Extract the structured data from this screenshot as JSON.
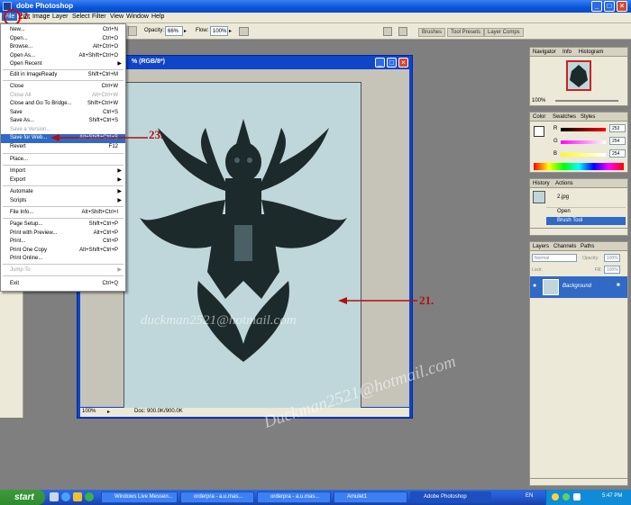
{
  "app": {
    "title": "Adobe Photoshop",
    "title_visible": "dobe Photoshop"
  },
  "menubar": [
    "File",
    "Edit",
    "Image",
    "Layer",
    "Select",
    "Filter",
    "View",
    "Window",
    "Help"
  ],
  "options_bar": {
    "opacity_label": "Opacity:",
    "opacity_value": "66%",
    "flow_label": "Flow:",
    "flow_value": "100%",
    "palette_tabs": [
      "Brushes",
      "Tool Presets",
      "Layer Comps"
    ]
  },
  "file_menu": {
    "items": [
      {
        "label": "New...",
        "shortcut": "Ctrl+N"
      },
      {
        "label": "Open...",
        "shortcut": "Ctrl+O"
      },
      {
        "label": "Browse...",
        "shortcut": "Alt+Ctrl+O"
      },
      {
        "label": "Open As...",
        "shortcut": "Alt+Shift+Ctrl+O"
      },
      {
        "label": "Open Recent",
        "submenu": true
      },
      {
        "label": "Edit in ImageReady",
        "shortcut": "Shift+Ctrl+M"
      },
      {
        "label": "Close",
        "shortcut": "Ctrl+W"
      },
      {
        "label": "Close All",
        "shortcut": "Alt+Ctrl+W",
        "disabled": true
      },
      {
        "label": "Close and Go To Bridge...",
        "shortcut": "Shift+Ctrl+W"
      },
      {
        "label": "Save",
        "shortcut": "Ctrl+S"
      },
      {
        "label": "Save As...",
        "shortcut": "Shift+Ctrl+S"
      },
      {
        "label": "Save a Version...",
        "disabled": true
      },
      {
        "label": "Save for Web...",
        "shortcut": "Alt+Shift+Ctrl+S",
        "highlighted": true
      },
      {
        "label": "Revert",
        "shortcut": "F12"
      },
      {
        "label": "Place..."
      },
      {
        "label": "Import",
        "submenu": true
      },
      {
        "label": "Export",
        "submenu": true
      },
      {
        "label": "Automate",
        "submenu": true
      },
      {
        "label": "Scripts",
        "submenu": true
      },
      {
        "label": "File Info...",
        "shortcut": "Alt+Shift+Ctrl+I"
      },
      {
        "label": "Page Setup...",
        "shortcut": "Shift+Ctrl+P"
      },
      {
        "label": "Print with Preview...",
        "shortcut": "Alt+Ctrl+P"
      },
      {
        "label": "Print...",
        "shortcut": "Ctrl+P"
      },
      {
        "label": "Print One Copy",
        "shortcut": "Alt+Shift+Ctrl+P"
      },
      {
        "label": "Print Online..."
      },
      {
        "label": "Jump To",
        "submenu": true,
        "disabled": true
      },
      {
        "label": "Exit",
        "shortcut": "Ctrl+Q"
      }
    ]
  },
  "document": {
    "title": "% (RGB/8*)",
    "zoom": "100%",
    "doc_size": "Doc: 900.0K/900.0K"
  },
  "watermark_canvas": "duckman2521@hotmail.com",
  "watermark_diagonal": "Duckman2521@hotmail.com",
  "annotations": {
    "file": "22.",
    "save_for_web": "23.",
    "canvas": "21."
  },
  "navigator": {
    "tabs": [
      "Navigator",
      "Info",
      "Histogram"
    ],
    "zoom": "100%"
  },
  "color_panel": {
    "tabs": [
      "Color",
      "Swatches",
      "Styles"
    ],
    "r_label": "R",
    "r_value": "253",
    "g_label": "G",
    "g_value": "254",
    "b_label": "B",
    "b_value": "254"
  },
  "history": {
    "tabs": [
      "History",
      "Actions"
    ],
    "snapshot": "2.jpg",
    "steps": [
      "Open",
      "Brush Tool"
    ]
  },
  "layers": {
    "tabs": [
      "Layers",
      "Channels",
      "Paths"
    ],
    "blend": "Normal",
    "opacity_label": "Opacity:",
    "opacity": "100%",
    "lock_label": "Lock:",
    "fill_label": "Fill:",
    "fill": "100%",
    "layer_name": "Background"
  },
  "taskbar": {
    "start": "start",
    "tasks": [
      "Windows Live Messen...",
      "orderpra - a.u.mas...",
      "orderpra - a.u.mas...",
      "Amulet1",
      "Adobe Photoshop"
    ],
    "lang": "EN",
    "time": "5:47 PM"
  }
}
